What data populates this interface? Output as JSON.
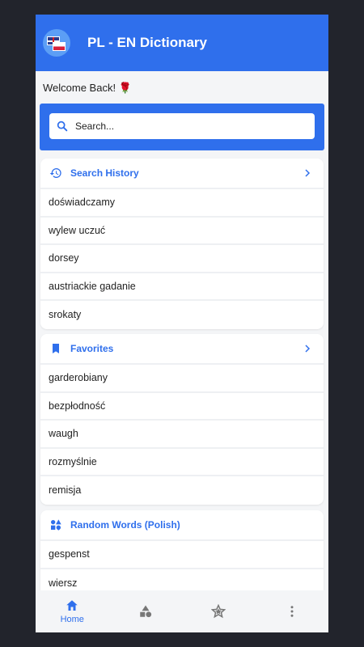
{
  "app": {
    "title": "PL - EN Dictionary"
  },
  "welcome": "Welcome Back! 🌹",
  "search": {
    "placeholder": "Search..."
  },
  "history": {
    "title": "Search History",
    "items": [
      "doświadczamy",
      "wylew uczuć",
      "dorsey",
      "austriackie gadanie",
      "srokaty"
    ]
  },
  "favorites": {
    "title": "Favorites",
    "items": [
      "garderobiany",
      "bezpłodność",
      "waugh",
      "rozmyślnie",
      "remisja"
    ]
  },
  "random": {
    "title": "Random Words (Polish)",
    "items": [
      "gespenst",
      "wiersz"
    ]
  },
  "nav": {
    "home_label": "Home",
    "items": [
      "home-icon",
      "shapes-icon",
      "star-icon",
      "more-vertical-icon"
    ]
  },
  "colors": {
    "primary": "#2f6fec",
    "background": "#f4f5f7",
    "frame": "#22242c"
  }
}
